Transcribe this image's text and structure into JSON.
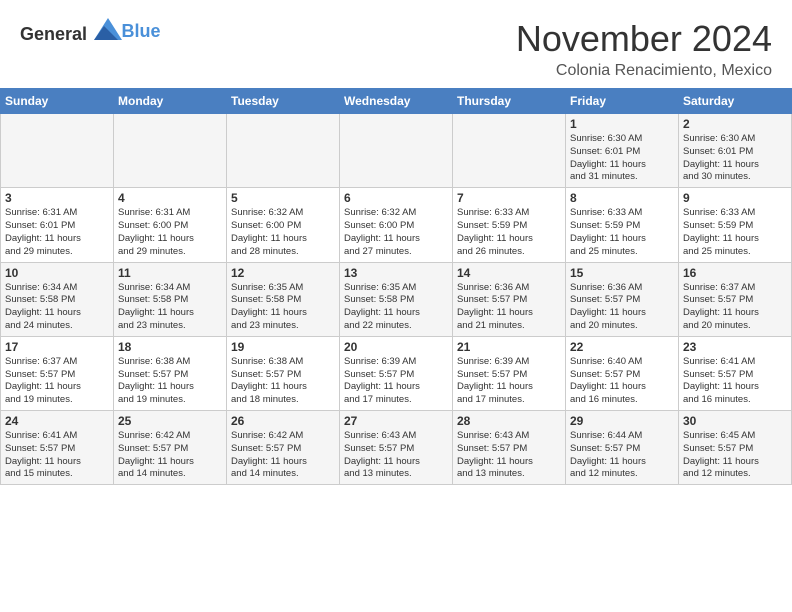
{
  "header": {
    "logo_general": "General",
    "logo_blue": "Blue",
    "month_title": "November 2024",
    "location": "Colonia Renacimiento, Mexico"
  },
  "calendar": {
    "days_of_week": [
      "Sunday",
      "Monday",
      "Tuesday",
      "Wednesday",
      "Thursday",
      "Friday",
      "Saturday"
    ],
    "weeks": [
      [
        {
          "day": "",
          "info": ""
        },
        {
          "day": "",
          "info": ""
        },
        {
          "day": "",
          "info": ""
        },
        {
          "day": "",
          "info": ""
        },
        {
          "day": "",
          "info": ""
        },
        {
          "day": "1",
          "info": "Sunrise: 6:30 AM\nSunset: 6:01 PM\nDaylight: 11 hours\nand 31 minutes."
        },
        {
          "day": "2",
          "info": "Sunrise: 6:30 AM\nSunset: 6:01 PM\nDaylight: 11 hours\nand 30 minutes."
        }
      ],
      [
        {
          "day": "3",
          "info": "Sunrise: 6:31 AM\nSunset: 6:01 PM\nDaylight: 11 hours\nand 29 minutes."
        },
        {
          "day": "4",
          "info": "Sunrise: 6:31 AM\nSunset: 6:00 PM\nDaylight: 11 hours\nand 29 minutes."
        },
        {
          "day": "5",
          "info": "Sunrise: 6:32 AM\nSunset: 6:00 PM\nDaylight: 11 hours\nand 28 minutes."
        },
        {
          "day": "6",
          "info": "Sunrise: 6:32 AM\nSunset: 6:00 PM\nDaylight: 11 hours\nand 27 minutes."
        },
        {
          "day": "7",
          "info": "Sunrise: 6:33 AM\nSunset: 5:59 PM\nDaylight: 11 hours\nand 26 minutes."
        },
        {
          "day": "8",
          "info": "Sunrise: 6:33 AM\nSunset: 5:59 PM\nDaylight: 11 hours\nand 25 minutes."
        },
        {
          "day": "9",
          "info": "Sunrise: 6:33 AM\nSunset: 5:59 PM\nDaylight: 11 hours\nand 25 minutes."
        }
      ],
      [
        {
          "day": "10",
          "info": "Sunrise: 6:34 AM\nSunset: 5:58 PM\nDaylight: 11 hours\nand 24 minutes."
        },
        {
          "day": "11",
          "info": "Sunrise: 6:34 AM\nSunset: 5:58 PM\nDaylight: 11 hours\nand 23 minutes."
        },
        {
          "day": "12",
          "info": "Sunrise: 6:35 AM\nSunset: 5:58 PM\nDaylight: 11 hours\nand 23 minutes."
        },
        {
          "day": "13",
          "info": "Sunrise: 6:35 AM\nSunset: 5:58 PM\nDaylight: 11 hours\nand 22 minutes."
        },
        {
          "day": "14",
          "info": "Sunrise: 6:36 AM\nSunset: 5:57 PM\nDaylight: 11 hours\nand 21 minutes."
        },
        {
          "day": "15",
          "info": "Sunrise: 6:36 AM\nSunset: 5:57 PM\nDaylight: 11 hours\nand 20 minutes."
        },
        {
          "day": "16",
          "info": "Sunrise: 6:37 AM\nSunset: 5:57 PM\nDaylight: 11 hours\nand 20 minutes."
        }
      ],
      [
        {
          "day": "17",
          "info": "Sunrise: 6:37 AM\nSunset: 5:57 PM\nDaylight: 11 hours\nand 19 minutes."
        },
        {
          "day": "18",
          "info": "Sunrise: 6:38 AM\nSunset: 5:57 PM\nDaylight: 11 hours\nand 19 minutes."
        },
        {
          "day": "19",
          "info": "Sunrise: 6:38 AM\nSunset: 5:57 PM\nDaylight: 11 hours\nand 18 minutes."
        },
        {
          "day": "20",
          "info": "Sunrise: 6:39 AM\nSunset: 5:57 PM\nDaylight: 11 hours\nand 17 minutes."
        },
        {
          "day": "21",
          "info": "Sunrise: 6:39 AM\nSunset: 5:57 PM\nDaylight: 11 hours\nand 17 minutes."
        },
        {
          "day": "22",
          "info": "Sunrise: 6:40 AM\nSunset: 5:57 PM\nDaylight: 11 hours\nand 16 minutes."
        },
        {
          "day": "23",
          "info": "Sunrise: 6:41 AM\nSunset: 5:57 PM\nDaylight: 11 hours\nand 16 minutes."
        }
      ],
      [
        {
          "day": "24",
          "info": "Sunrise: 6:41 AM\nSunset: 5:57 PM\nDaylight: 11 hours\nand 15 minutes."
        },
        {
          "day": "25",
          "info": "Sunrise: 6:42 AM\nSunset: 5:57 PM\nDaylight: 11 hours\nand 14 minutes."
        },
        {
          "day": "26",
          "info": "Sunrise: 6:42 AM\nSunset: 5:57 PM\nDaylight: 11 hours\nand 14 minutes."
        },
        {
          "day": "27",
          "info": "Sunrise: 6:43 AM\nSunset: 5:57 PM\nDaylight: 11 hours\nand 13 minutes."
        },
        {
          "day": "28",
          "info": "Sunrise: 6:43 AM\nSunset: 5:57 PM\nDaylight: 11 hours\nand 13 minutes."
        },
        {
          "day": "29",
          "info": "Sunrise: 6:44 AM\nSunset: 5:57 PM\nDaylight: 11 hours\nand 12 minutes."
        },
        {
          "day": "30",
          "info": "Sunrise: 6:45 AM\nSunset: 5:57 PM\nDaylight: 11 hours\nand 12 minutes."
        }
      ]
    ]
  }
}
